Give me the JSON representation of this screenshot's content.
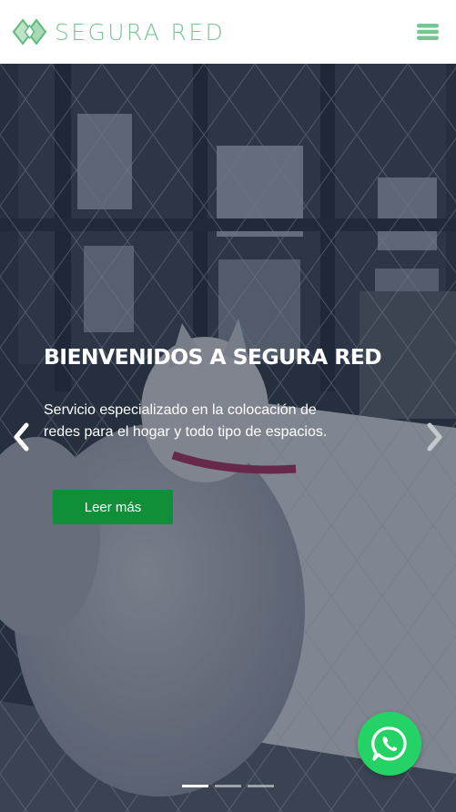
{
  "header": {
    "brand_name": "SEGURA RED",
    "brand_color": "#77c593",
    "logo_icon": "diamond-logo-icon",
    "menu_icon": "hamburger-menu-icon"
  },
  "hero": {
    "title": "BIENVENIDOS A SEGURA RED",
    "description": "Servicio especializado en la colocación de redes para el hogar y todo tipo de espacios.",
    "cta_label": "Leer más",
    "cta_color": "#0f8f37",
    "prev_icon": "chevron-left-icon",
    "next_icon": "chevron-right-icon",
    "slides_total": 3,
    "active_slide": 1
  },
  "whatsapp": {
    "icon": "whatsapp-icon",
    "color": "#24d265"
  }
}
